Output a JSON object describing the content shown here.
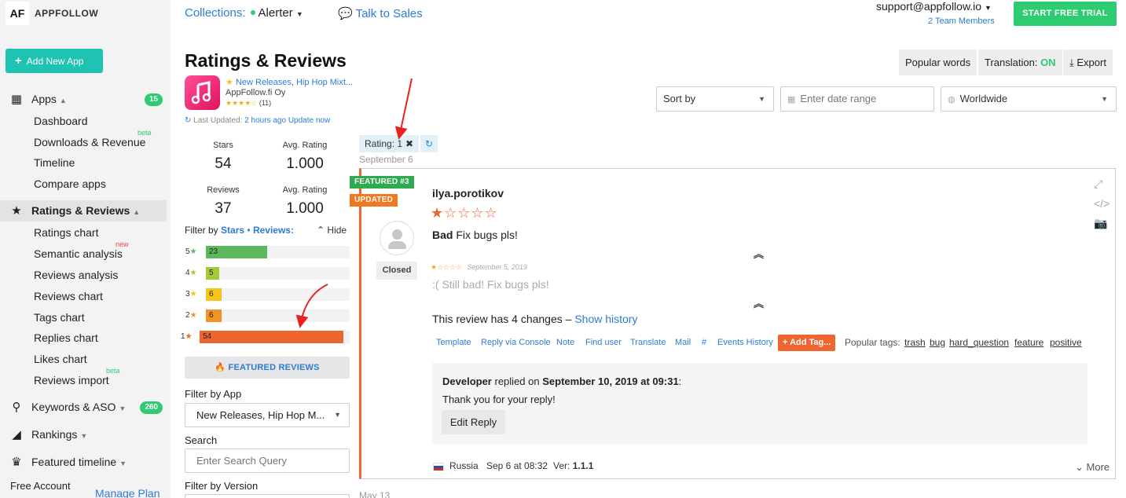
{
  "sidebar": {
    "logo_text": "AF",
    "brand": "APPFOLLOW",
    "add_app_label": "Add New App",
    "apps_label": "Apps",
    "apps_count": "15",
    "apps_items": [
      "Dashboard",
      "Downloads & Revenue",
      "Timeline",
      "Compare apps"
    ],
    "beta_tag": "beta",
    "new_tag": "new",
    "ratings_label": "Ratings & Reviews",
    "ratings_items": [
      "Ratings chart",
      "Semantic analysis",
      "Reviews analysis",
      "Reviews chart",
      "Tags chart",
      "Replies chart",
      "Likes chart",
      "Reviews import"
    ],
    "keywords_label": "Keywords & ASO",
    "keywords_count": "260",
    "rankings_label": "Rankings",
    "featured_label": "Featured timeline",
    "free_account": "Free Account",
    "manage_plan": "Manage Plan"
  },
  "header": {
    "collections_label": "Collections:",
    "collection_name": "Alerter",
    "talk_to_sales": "Talk to Sales",
    "email": "support@appfollow.io",
    "team_members": "2 Team Members",
    "trial_button": "START FREE TRIAL"
  },
  "page": {
    "title": "Ratings & Reviews",
    "popular_words": "Popular words",
    "translation_label": "Translation:",
    "translation_state": "ON",
    "export": "Export"
  },
  "app": {
    "name": "New Releases, Hip Hop Mixt...",
    "developer": "AppFollow.fi Oy",
    "rating_count": "(11)",
    "last_updated_label": "Last Updated:",
    "last_updated_value": "2 hours ago",
    "update_now": "Update now"
  },
  "filters": {
    "sort_by": "Sort by",
    "date_range_placeholder": "Enter date range",
    "region": "Worldwide"
  },
  "stats": {
    "stars_label": "Stars",
    "stars_value": "54",
    "avg_rating_label": "Avg. Rating",
    "avg_rating_stars": "1.000",
    "reviews_label": "Reviews",
    "reviews_value": "37",
    "avg_rating_reviews": "1.000"
  },
  "filter_by": {
    "label": "Filter by",
    "stars_link": "Stars",
    "separator": "•",
    "reviews_link": "Reviews:",
    "hide": "Hide"
  },
  "distribution": [
    {
      "star": "5",
      "count": 23,
      "color": "#5cb85c"
    },
    {
      "star": "4",
      "count": 5,
      "color": "#a5c93b"
    },
    {
      "star": "3",
      "count": 6,
      "color": "#f5c518"
    },
    {
      "star": "2",
      "count": 6,
      "color": "#f0932b"
    },
    {
      "star": "1",
      "count": 54,
      "color": "#f0652f"
    }
  ],
  "featured_reviews_btn": "FEATURED REVIEWS",
  "filter_app": {
    "label": "Filter by App",
    "value": "New Releases, Hip Hop M..."
  },
  "search": {
    "label": "Search",
    "placeholder": "Enter Search Query"
  },
  "filter_version_label": "Filter by Version",
  "chip": {
    "label": "Rating: 1"
  },
  "date_sep": "September 6",
  "date_bottom": "May 13",
  "review": {
    "featured_label": "FEATURED #3",
    "updated_label": "UPDATED",
    "status": "Closed",
    "author": "ilya.porotikov",
    "rating": 1,
    "title": "Bad",
    "body": "Fix bugs pls!",
    "old_date": "September 5, 2019",
    "old_text": ":( Still bad! Fix bugs pls!",
    "changes_text": "This review has 4 changes –",
    "show_history": "Show history",
    "actions": [
      "Template",
      "Reply via Console",
      "Note",
      "Find user",
      "Translate",
      "Mail",
      "#",
      "Events History"
    ],
    "add_tag": "Add Tag...",
    "popular_tags_label": "Popular tags:",
    "popular_tags": [
      "trash",
      "bug",
      "hard_question",
      "feature",
      "positive"
    ],
    "reply_author": "Developer",
    "reply_on": "replied on",
    "reply_date": "September 10, 2019 at 09:31",
    "reply_colon": ":",
    "reply_text": "Thank you for your reply!",
    "edit_reply": "Edit Reply",
    "country": "Russia",
    "date": "Sep 6 at 08:32",
    "version_label": "Ver:",
    "version": "1.1.1",
    "more": "More"
  }
}
